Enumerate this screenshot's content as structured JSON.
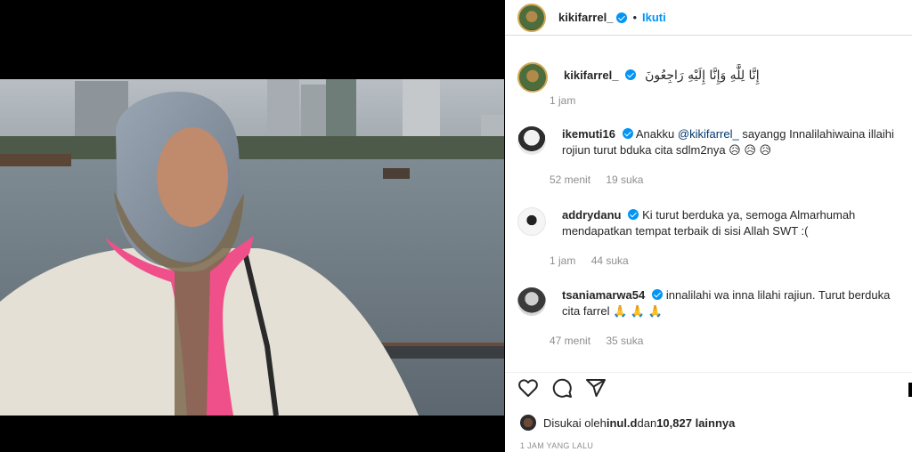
{
  "post": {
    "author": "kikifarrel_",
    "follow_label": "Ikuti",
    "dot": "•",
    "caption": "إِنَّا لِلَّٰهِ وَإِنَّا إِلَيْهِ رَاجِعُونَ",
    "caption_time": "1 jam"
  },
  "comments": [
    {
      "user": "ikemuti16",
      "text_before": "Anakku ",
      "mention": "@kikifarrel_",
      "text_after": " sayangg Innalilahiwaina illaihi rojiun turut bduka cita sdlm2nya 😥 😥 😥",
      "time": "52 menit",
      "likes": "19 suka"
    },
    {
      "user": "addrydanu",
      "text": "Ki turut berduka ya, semoga Almarhumah mendapatkan tempat terbaik di sisi Allah SWT :(",
      "time": "1 jam",
      "likes": "44 suka"
    },
    {
      "user": "tsaniamarwa54",
      "text": "innalilahi wa inna lilahi rajiun. Turut berduka cita farrel 🙏 🙏 🙏",
      "time": "47 menit",
      "likes": "35 suka"
    }
  ],
  "likes_line": {
    "prefix": "Disukai oleh ",
    "user": "inul.d",
    "middle": " dan ",
    "count": "10,827 lainnya"
  },
  "time_ago": "1 JAM YANG LALU",
  "icons": [
    "heart-icon",
    "comment-icon",
    "share-icon"
  ],
  "colors": {
    "accent": "#0095f6",
    "mention": "#00376b",
    "muted": "#8e8e8e"
  }
}
